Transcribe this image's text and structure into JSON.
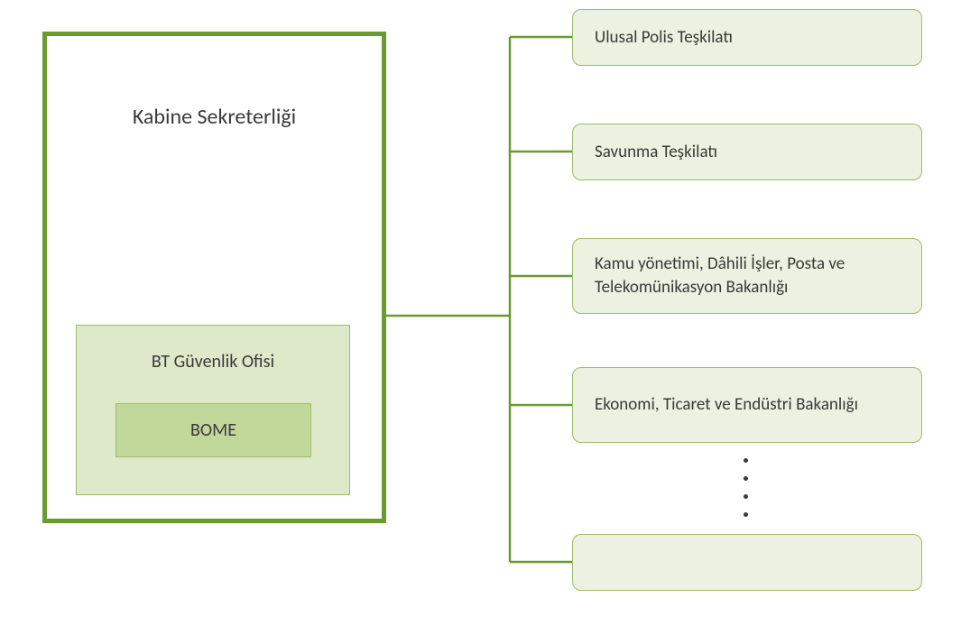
{
  "main": {
    "title": "Kabine Sekreterliği",
    "inner": {
      "title": "BT Güvenlik Ofisi",
      "inner2": "BOME"
    }
  },
  "leaves": {
    "item1": "Ulusal Polis Teşkilatı",
    "item2": "Savunma Teşkilatı",
    "item3": "Kamu yönetimi, Dâhili İşler, Posta ve Telekomünikasyon Bakanlığı",
    "item4": "Ekonomi, Ticaret ve Endüstri Bakanlığı",
    "item5": ""
  },
  "colors": {
    "borderDark": "#6b9a2f",
    "fillLight": "#ecf1e1",
    "fillMed": "#dde9c8",
    "fillDark": "#c2d79a"
  }
}
